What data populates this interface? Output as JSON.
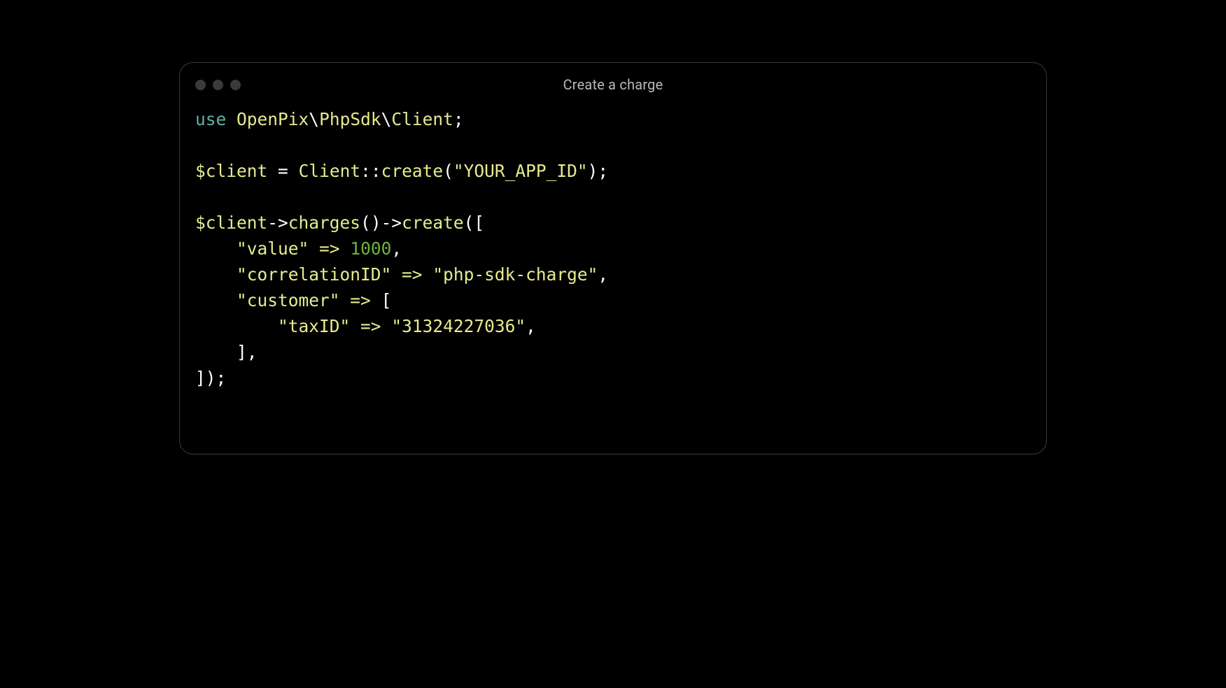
{
  "window": {
    "title": "Create a charge"
  },
  "code": {
    "kw_use": "use",
    "ns1": "OpenPix",
    "bs": "\\",
    "ns2": "PhpSdk",
    "ns3": "Client",
    "semi": ";",
    "var_client": "$client",
    "eq": "=",
    "cls_client": "Client",
    "dcolon": "::",
    "fn_create": "create",
    "lp": "(",
    "rp": ")",
    "str_appid": "\"YOUR_APP_ID\"",
    "arrow": "->",
    "fn_charges": "charges",
    "lb": "[",
    "rb": "]",
    "str_value": "\"value\"",
    "fat": "=>",
    "num_1000": "1000",
    "comma": ",",
    "str_corr": "\"correlationID\"",
    "str_corr_val": "\"php-sdk-charge\"",
    "str_customer": "\"customer\"",
    "str_taxid": "\"taxID\"",
    "str_taxid_val": "\"31324227036\""
  }
}
